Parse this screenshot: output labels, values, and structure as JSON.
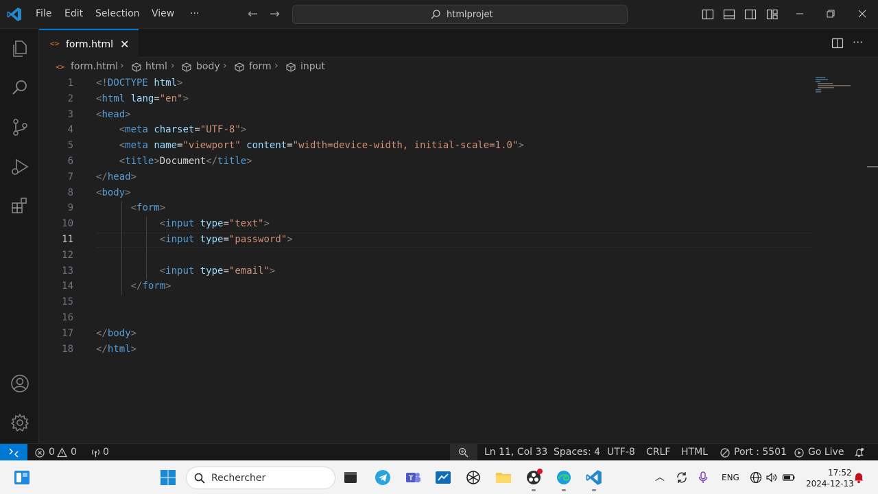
{
  "titlebar": {
    "menu": [
      "File",
      "Edit",
      "Selection",
      "View",
      "···"
    ],
    "search_text": "htmlprojet"
  },
  "tab": {
    "label": "form.html"
  },
  "breadcrumb": [
    "form.html",
    "html",
    "body",
    "form",
    "input"
  ],
  "editor": {
    "current_line": 11,
    "lines": [
      [
        [
          "b",
          "<!"
        ],
        [
          "t",
          "DOCTYPE"
        ],
        [
          "x",
          " "
        ],
        [
          "a",
          "html"
        ],
        [
          "b",
          ">"
        ]
      ],
      [
        [
          "b",
          "<"
        ],
        [
          "t",
          "html"
        ],
        [
          "x",
          " "
        ],
        [
          "a",
          "lang"
        ],
        [
          "x",
          "="
        ],
        [
          "s",
          "\"en\""
        ],
        [
          "b",
          ">"
        ]
      ],
      [
        [
          "b",
          "<"
        ],
        [
          "t",
          "head"
        ],
        [
          "b",
          ">"
        ]
      ],
      [
        [
          "x",
          "    "
        ],
        [
          "b",
          "<"
        ],
        [
          "t",
          "meta"
        ],
        [
          "x",
          " "
        ],
        [
          "a",
          "charset"
        ],
        [
          "x",
          "="
        ],
        [
          "s",
          "\"UTF-8\""
        ],
        [
          "b",
          ">"
        ]
      ],
      [
        [
          "x",
          "    "
        ],
        [
          "b",
          "<"
        ],
        [
          "t",
          "meta"
        ],
        [
          "x",
          " "
        ],
        [
          "a",
          "name"
        ],
        [
          "x",
          "="
        ],
        [
          "s",
          "\"viewport\""
        ],
        [
          "x",
          " "
        ],
        [
          "a",
          "content"
        ],
        [
          "x",
          "="
        ],
        [
          "s",
          "\"width=device-width, initial-scale=1.0\""
        ],
        [
          "b",
          ">"
        ]
      ],
      [
        [
          "x",
          "    "
        ],
        [
          "b",
          "<"
        ],
        [
          "t",
          "title"
        ],
        [
          "b",
          ">"
        ],
        [
          "x",
          "Document"
        ],
        [
          "b",
          "</"
        ],
        [
          "t",
          "title"
        ],
        [
          "b",
          ">"
        ]
      ],
      [
        [
          "b",
          "</"
        ],
        [
          "t",
          "head"
        ],
        [
          "b",
          ">"
        ]
      ],
      [
        [
          "b",
          "<"
        ],
        [
          "t",
          "body"
        ],
        [
          "b",
          ">"
        ]
      ],
      [
        [
          "x",
          "      "
        ],
        [
          "b",
          "<"
        ],
        [
          "t",
          "form"
        ],
        [
          "b",
          ">"
        ]
      ],
      [
        [
          "x",
          "           "
        ],
        [
          "b",
          "<"
        ],
        [
          "t",
          "input"
        ],
        [
          "x",
          " "
        ],
        [
          "a",
          "type"
        ],
        [
          "x",
          "="
        ],
        [
          "s",
          "\"text\""
        ],
        [
          "b",
          ">"
        ]
      ],
      [
        [
          "x",
          "           "
        ],
        [
          "b",
          "<"
        ],
        [
          "t",
          "input"
        ],
        [
          "x",
          " "
        ],
        [
          "a",
          "type"
        ],
        [
          "x",
          "="
        ],
        [
          "s",
          "\"password\""
        ],
        [
          "b",
          ">"
        ]
      ],
      [],
      [
        [
          "x",
          "           "
        ],
        [
          "b",
          "<"
        ],
        [
          "t",
          "input"
        ],
        [
          "x",
          " "
        ],
        [
          "a",
          "type"
        ],
        [
          "x",
          "="
        ],
        [
          "s",
          "\"email\""
        ],
        [
          "b",
          ">"
        ]
      ],
      [
        [
          "x",
          "      "
        ],
        [
          "b",
          "</"
        ],
        [
          "t",
          "form"
        ],
        [
          "b",
          ">"
        ]
      ],
      [],
      [],
      [
        [
          "b",
          "</"
        ],
        [
          "t",
          "body"
        ],
        [
          "b",
          ">"
        ]
      ],
      [
        [
          "b",
          "</"
        ],
        [
          "t",
          "html"
        ],
        [
          "b",
          ">"
        ]
      ]
    ]
  },
  "statusbar": {
    "errors": "0",
    "warnings": "0",
    "ports": "0",
    "position": "Ln 11, Col 33",
    "spaces": "Spaces: 4",
    "encoding": "UTF-8",
    "eol": "CRLF",
    "language": "HTML",
    "port": "Port : 5501",
    "golive": "Go Live"
  },
  "taskbar": {
    "search_placeholder": "Rechercher",
    "language": "ENG",
    "time": "17:52",
    "date": "2024-12-13"
  },
  "colors": {
    "accent": "#0078d4",
    "tag": "#569cd6",
    "attribute": "#9cdcfe",
    "string": "#ce9178",
    "bracket": "#808080"
  }
}
